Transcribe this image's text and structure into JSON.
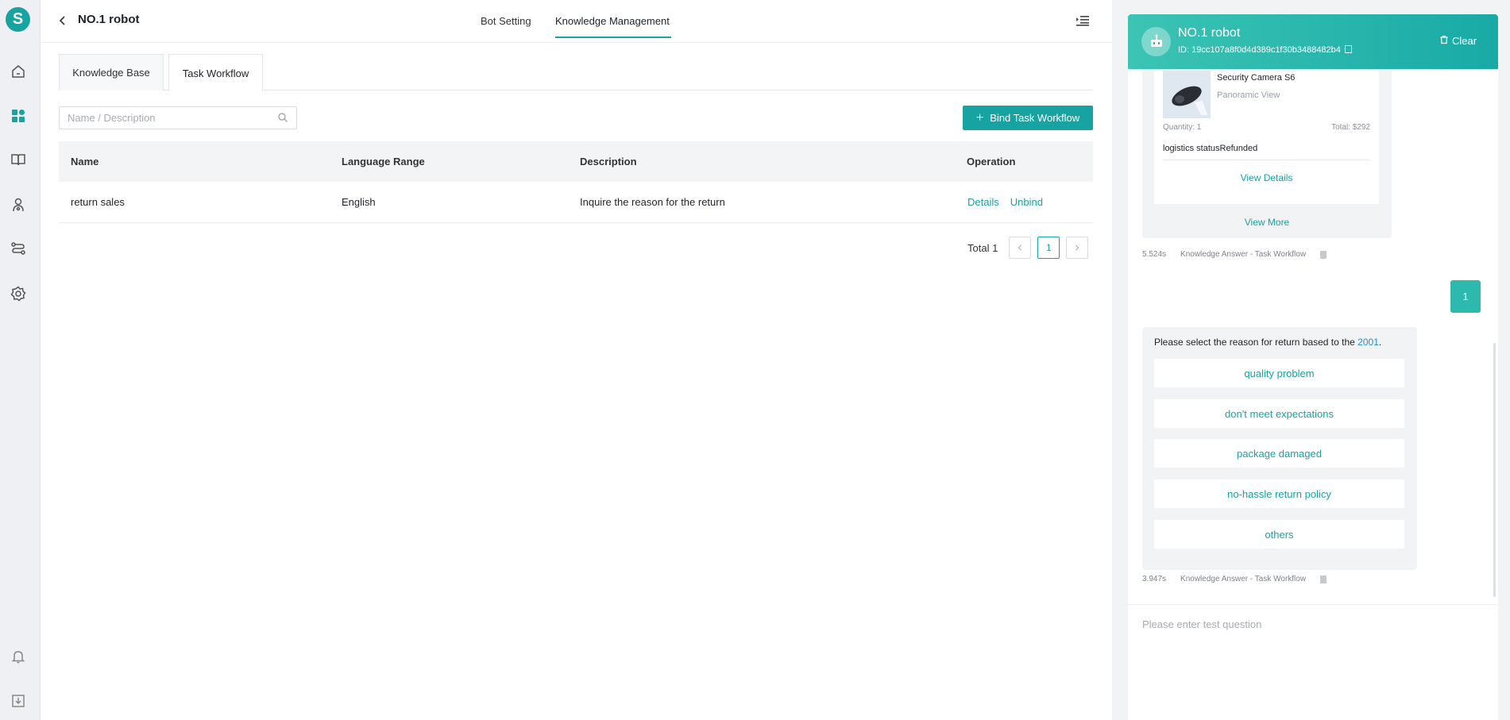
{
  "header": {
    "robot_name": "NO.1 robot",
    "tabs": [
      {
        "label": "Bot Setting",
        "active": false
      },
      {
        "label": "Knowledge Management",
        "active": true
      }
    ]
  },
  "subtabs": [
    {
      "label": "Knowledge Base",
      "active": false
    },
    {
      "label": "Task Workflow",
      "active": true
    }
  ],
  "search": {
    "placeholder": "Name / Description",
    "value": ""
  },
  "bind_button": {
    "label": "Bind Task Workflow"
  },
  "table": {
    "columns": [
      "Name",
      "Language Range",
      "Description",
      "Operation"
    ],
    "rows": [
      {
        "name": "return sales",
        "language": "English",
        "description": "Inquire the reason for the return",
        "ops": [
          "Details",
          "Unbind"
        ]
      }
    ]
  },
  "pagination": {
    "total_label": "Total 1",
    "current_page": "1",
    "prev": "<",
    "next": ">"
  },
  "chat": {
    "bot_name": "NO.1 robot",
    "bot_id": "ID: 19cc107a8f0d4d389c1f30b3488482b4",
    "clear_label": "Clear",
    "order": {
      "product_name": "Security Camera S6",
      "product_sub": "Panoramic View",
      "quantity": "Quantity: 1",
      "total": "Total: $292",
      "logistics": "logistics statusRefunded",
      "view_details": "View Details",
      "view_more": "View More"
    },
    "meta1": {
      "time": "5.524s",
      "source": "Knowledge Answer - Task Workflow"
    },
    "user_message": "1",
    "prompt_text": "Please select the reason for  return based to the",
    "prompt_number": "2001",
    "prompt_end": ".",
    "options": [
      "quality problem",
      "don't meet expectations",
      "package damaged",
      "no-hassle return policy",
      "others"
    ],
    "meta2": {
      "time": "3.947s",
      "source": "Knowledge Answer - Task Workflow"
    },
    "input_placeholder": "Please enter test question"
  },
  "colors": {
    "accent": "#17a3a1",
    "header_gradient_start": "#3cc4b4",
    "link_blue": "#1f8ed8"
  },
  "icons": {
    "rail": [
      "home-icon",
      "dashboard-icon",
      "book-icon",
      "robot-icon",
      "route-icon",
      "settings-icon",
      "bell-icon",
      "download-icon"
    ]
  }
}
